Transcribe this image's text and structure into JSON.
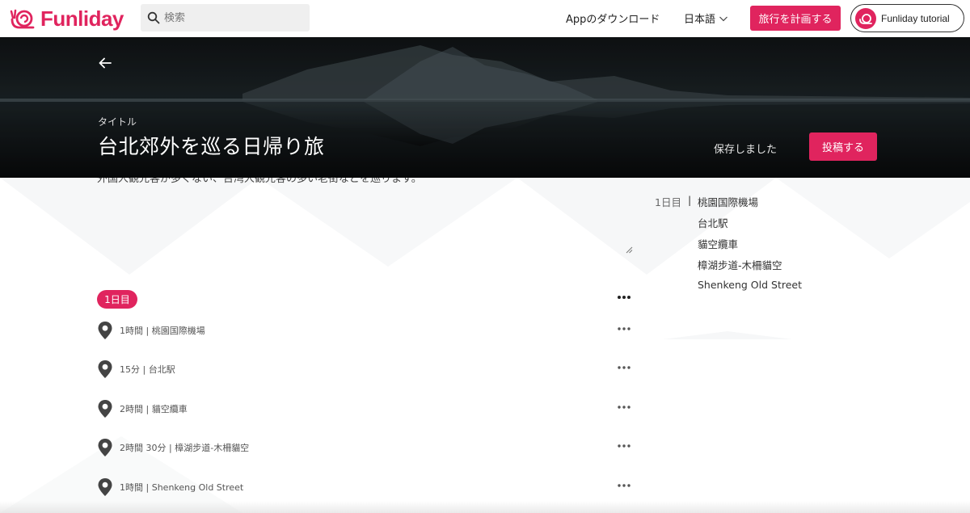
{
  "brand": {
    "name": "Funliday",
    "color": "#e0245e"
  },
  "search": {
    "placeholder": "検索",
    "icon": "search-icon"
  },
  "nav": {
    "download": "Appのダウンロード",
    "language": "日本語",
    "plan_button": "旅行を計画する",
    "user_name": "Funliday tutorial"
  },
  "hero": {
    "label": "タイトル",
    "title": "台北郊外を巡る日帰り旅",
    "saved_text": "保存しました",
    "post_button": "投稿する"
  },
  "description": "外国人観光客が多くない、台湾人観光客の多い老街などを巡ります。",
  "day": {
    "label": "1日目",
    "stops": [
      {
        "duration": "1時間",
        "place": "桃園国際機場"
      },
      {
        "duration": "15分",
        "place": "台北駅"
      },
      {
        "duration": "2時間",
        "place": " 貓空纜車"
      },
      {
        "duration": "2時間 30分",
        "place": "樟湖步道-木柵貓空"
      },
      {
        "duration": "1時間",
        "place": "Shenkeng Old Street"
      }
    ]
  },
  "summary": {
    "day_label": "1日目",
    "separator": "|",
    "items": [
      "桃園国際機場",
      "台北駅",
      "貓空纜車",
      "樟湖步道-木柵貓空",
      "Shenkeng Old Street"
    ]
  },
  "stop_separator": "|"
}
